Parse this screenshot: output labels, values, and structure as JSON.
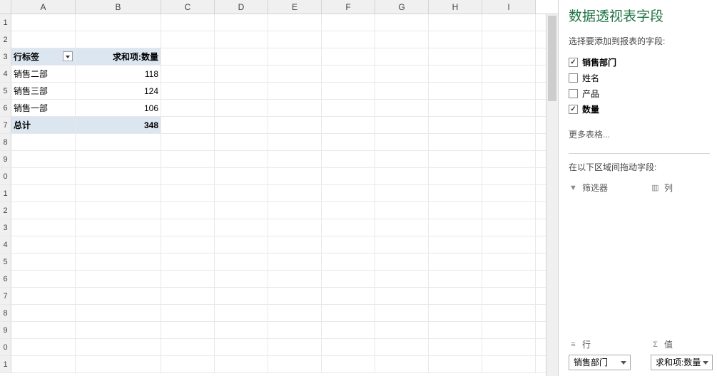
{
  "columns": [
    "A",
    "B",
    "C",
    "D",
    "E",
    "F",
    "G",
    "H",
    "I"
  ],
  "rows": [
    "1",
    "2",
    "3",
    "4",
    "5",
    "6",
    "7",
    "8",
    "9",
    "0",
    "1",
    "2",
    "3",
    "4",
    "5",
    "6",
    "7",
    "8",
    "9",
    "0",
    "1"
  ],
  "pivot": {
    "row_label_header": "行标签",
    "value_header": "求和项:数量",
    "rows": [
      {
        "label": "销售二部",
        "value": "118"
      },
      {
        "label": "销售三部",
        "value": "124"
      },
      {
        "label": "销售一部",
        "value": "106"
      }
    ],
    "total_label": "总计",
    "total_value": "348"
  },
  "panel": {
    "title": "数据透视表字段",
    "subtitle": "选择要添加到报表的字段:",
    "fields": [
      {
        "name": "销售部门",
        "checked": true
      },
      {
        "name": "姓名",
        "checked": false
      },
      {
        "name": "产品",
        "checked": false
      },
      {
        "name": "数量",
        "checked": true
      }
    ],
    "more_tables": "更多表格...",
    "drag_label": "在以下区域间拖动字段:",
    "area_filter": "筛选器",
    "area_columns": "列",
    "area_rows": "行",
    "area_values": "值",
    "rows_field": "销售部门",
    "values_field": "求和项:数量"
  }
}
